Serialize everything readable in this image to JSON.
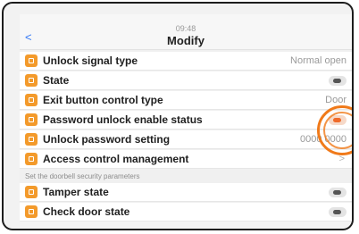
{
  "header": {
    "back_label": "<",
    "time": "09:48",
    "title": "Modify"
  },
  "rows": [
    {
      "label": "Unlock signal type",
      "value": "Normal open",
      "icon": "unlock-signal-icon"
    },
    {
      "label": "State",
      "toggle": "off",
      "icon": "state-icon"
    },
    {
      "label": "Exit button control type",
      "value": "Door",
      "icon": "exit-button-icon"
    },
    {
      "label": "Password unlock enable status",
      "toggle": "on",
      "icon": "password-shield-icon"
    },
    {
      "label": "Unlock password setting",
      "value": "0000 0000",
      "icon": "password-setting-icon"
    },
    {
      "label": "Access control management",
      "chevron": ">",
      "icon": "access-control-icon"
    }
  ],
  "section_header": "Set the doorbell security parameters",
  "rows2": [
    {
      "label": "Tamper state",
      "toggle": "off",
      "icon": "tamper-icon"
    },
    {
      "label": "Check door state",
      "toggle": "off",
      "icon": "door-state-icon"
    }
  ],
  "colors": {
    "accent": "#f39a2b",
    "highlight": "#f07a1a",
    "toggle_on": "#ef6a2a",
    "link": "#3478f6"
  }
}
